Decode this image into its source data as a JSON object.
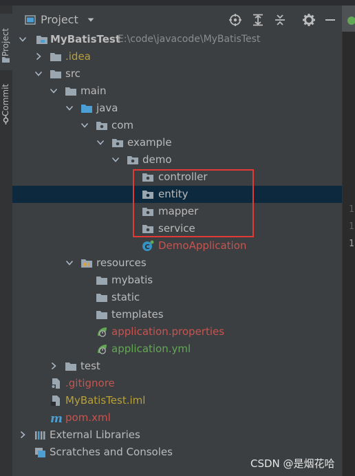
{
  "window": {
    "left_tabs": [
      {
        "label": "Project",
        "active": true
      },
      {
        "label": "Commit",
        "active": false
      }
    ]
  },
  "header": {
    "title": "Project",
    "toolbar_icons": [
      "locate-icon",
      "expand-all-icon",
      "collapse-all-icon",
      "gear-icon",
      "minimize-icon"
    ]
  },
  "tree": {
    "root": {
      "label": "MyBatisTest",
      "path": "E:\\code\\javacode\\MyBatisTest"
    },
    "idea": ".idea",
    "src": "src",
    "main": "main",
    "java": "java",
    "com": "com",
    "example": "example",
    "demo": "demo",
    "controller": "controller",
    "entity": "entity",
    "mapper": "mapper",
    "service": "service",
    "demo_application": "DemoApplication",
    "resources": "resources",
    "mybatis": "mybatis",
    "static": "static",
    "templates": "templates",
    "application_properties": "application.properties",
    "application_yml": "application.yml",
    "test": "test",
    "gitignore": ".gitignore",
    "iml": "MyBatisTest.iml",
    "pom": "pom.xml",
    "external_libraries": "External Libraries",
    "scratches": "Scratches and Consoles"
  },
  "editor": {
    "gutter_numbers": [
      "1",
      "1",
      "1"
    ]
  },
  "watermark": "CSDN @是烟花哈",
  "colors": {
    "panel_bg": "#3c3f41",
    "selection": "#0d293e",
    "highlight_box": "#e53935",
    "folder_blue": "#4b9fd5",
    "folder_gray": "#9aa7b0"
  }
}
